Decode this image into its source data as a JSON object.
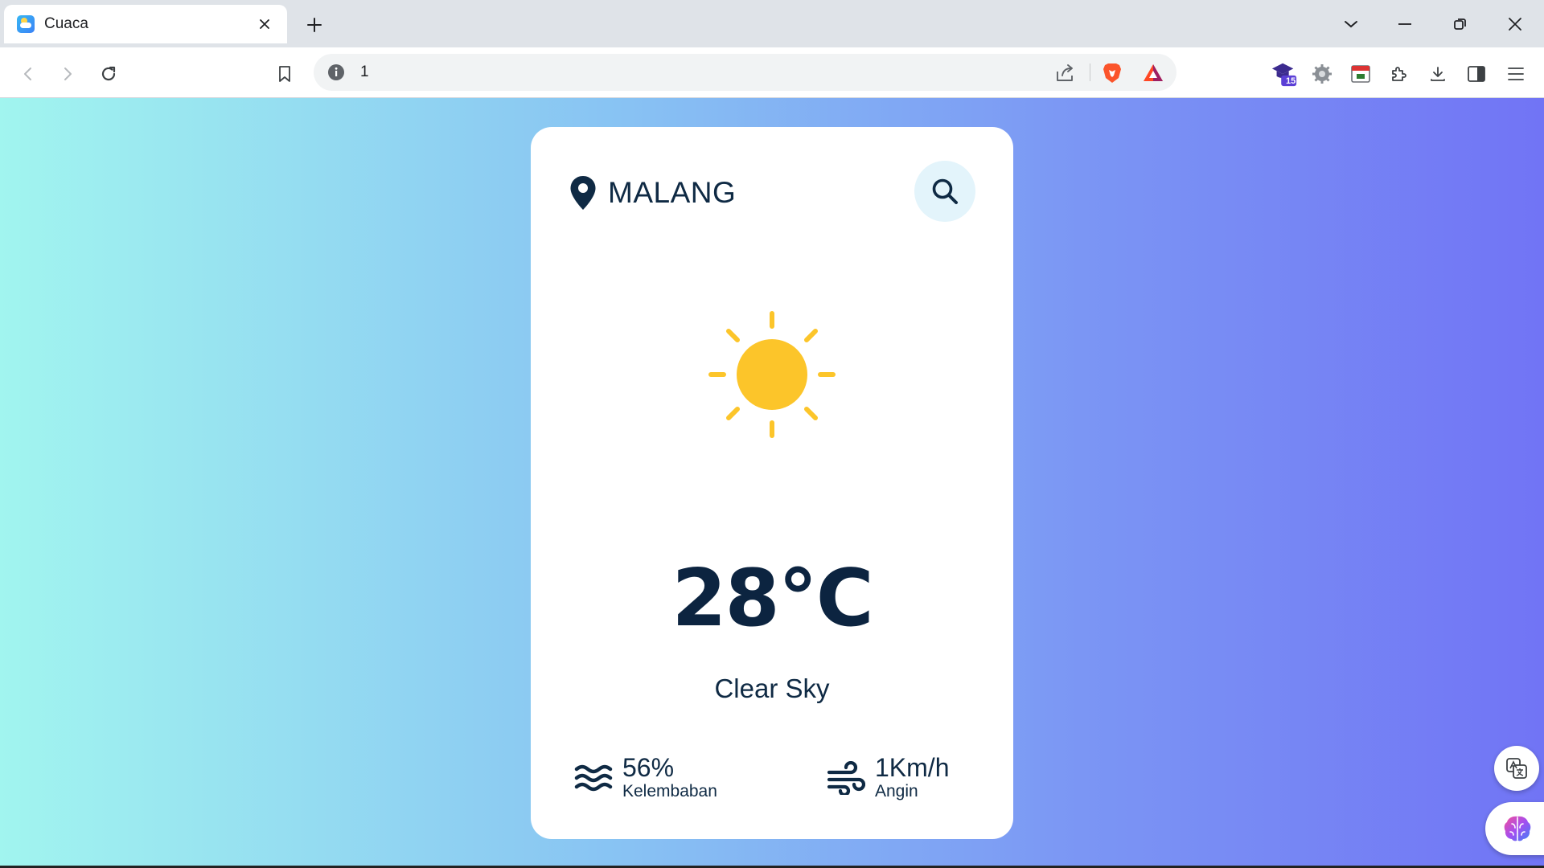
{
  "browser": {
    "tab": {
      "title": "Cuaca"
    },
    "address": {
      "url": "1"
    },
    "extensions": {
      "badge_count": "15"
    }
  },
  "weather": {
    "city": "MALANG",
    "temperature": "28°C",
    "description": "Clear Sky",
    "humidity": {
      "value": "56%",
      "label": "Kelembaban"
    },
    "wind": {
      "value": "1Km/h",
      "label": "Angin"
    }
  },
  "colors": {
    "sun": "#fcc52a",
    "text_dark": "#0f2a44",
    "gradient_start": "#a1f5ef",
    "gradient_end": "#7174f5",
    "search_bg": "#e3f4fb"
  }
}
